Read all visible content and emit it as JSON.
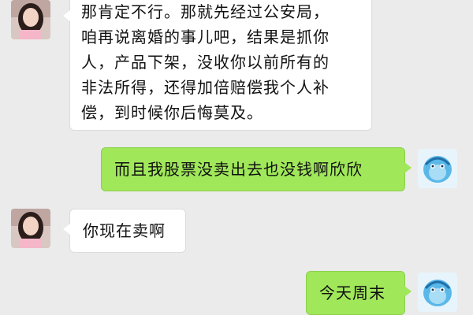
{
  "messages": [
    {
      "side": "left",
      "avatar": "girl-avatar-icon",
      "lines": [
        "那肯定不行。那就先经过公安局，",
        "咱再说离婚的事儿吧，结果是抓你",
        "人，产品下架，没收你以前所有的",
        "非法所得，还得加倍赔偿我个人补",
        "偿，到时候你后悔莫及。"
      ]
    },
    {
      "side": "right",
      "avatar": "blue-mascot-avatar-icon",
      "lines": [
        "而且我股票没卖出去也没钱啊欣欣"
      ]
    },
    {
      "side": "left",
      "avatar": "girl-avatar-icon",
      "lines": [
        "你现在卖啊"
      ]
    },
    {
      "side": "right",
      "avatar": "blue-mascot-avatar-icon",
      "lines": [
        "今天周末"
      ]
    }
  ],
  "colors": {
    "background": "#ebebeb",
    "incoming_bubble": "#ffffff",
    "outgoing_bubble": "#a0e75a"
  }
}
